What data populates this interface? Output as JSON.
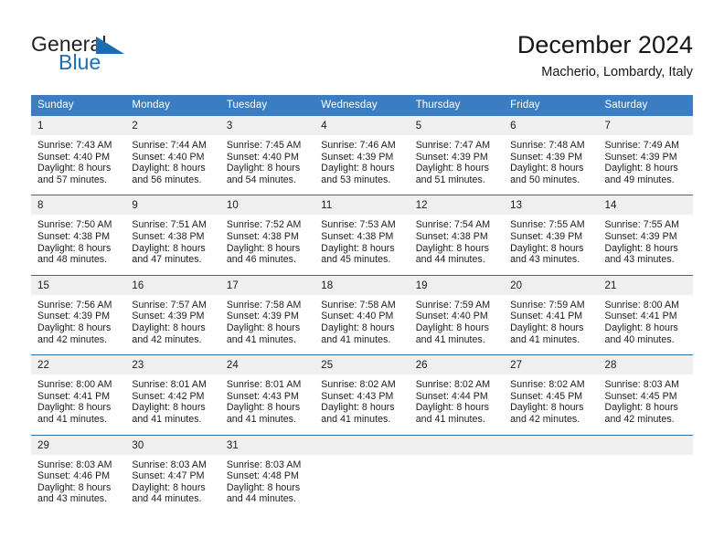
{
  "brand": {
    "name_part1": "General",
    "name_part2": "Blue",
    "accent_color": "#1b6cb0"
  },
  "header": {
    "title": "December 2024",
    "location": "Macherio, Lombardy, Italy"
  },
  "theme": {
    "header_row_bg": "#3a7dc1",
    "week_divider": "#2e6da4",
    "daynum_bg": "#efefef",
    "text": "#1b1b1b"
  },
  "weekday_headers": [
    "Sunday",
    "Monday",
    "Tuesday",
    "Wednesday",
    "Thursday",
    "Friday",
    "Saturday"
  ],
  "weeks": [
    [
      {
        "day": "1",
        "sunrise": "Sunrise: 7:43 AM",
        "sunset": "Sunset: 4:40 PM",
        "daylight_line1": "Daylight: 8 hours",
        "daylight_line2": "and 57 minutes."
      },
      {
        "day": "2",
        "sunrise": "Sunrise: 7:44 AM",
        "sunset": "Sunset: 4:40 PM",
        "daylight_line1": "Daylight: 8 hours",
        "daylight_line2": "and 56 minutes."
      },
      {
        "day": "3",
        "sunrise": "Sunrise: 7:45 AM",
        "sunset": "Sunset: 4:40 PM",
        "daylight_line1": "Daylight: 8 hours",
        "daylight_line2": "and 54 minutes."
      },
      {
        "day": "4",
        "sunrise": "Sunrise: 7:46 AM",
        "sunset": "Sunset: 4:39 PM",
        "daylight_line1": "Daylight: 8 hours",
        "daylight_line2": "and 53 minutes."
      },
      {
        "day": "5",
        "sunrise": "Sunrise: 7:47 AM",
        "sunset": "Sunset: 4:39 PM",
        "daylight_line1": "Daylight: 8 hours",
        "daylight_line2": "and 51 minutes."
      },
      {
        "day": "6",
        "sunrise": "Sunrise: 7:48 AM",
        "sunset": "Sunset: 4:39 PM",
        "daylight_line1": "Daylight: 8 hours",
        "daylight_line2": "and 50 minutes."
      },
      {
        "day": "7",
        "sunrise": "Sunrise: 7:49 AM",
        "sunset": "Sunset: 4:39 PM",
        "daylight_line1": "Daylight: 8 hours",
        "daylight_line2": "and 49 minutes."
      }
    ],
    [
      {
        "day": "8",
        "sunrise": "Sunrise: 7:50 AM",
        "sunset": "Sunset: 4:38 PM",
        "daylight_line1": "Daylight: 8 hours",
        "daylight_line2": "and 48 minutes."
      },
      {
        "day": "9",
        "sunrise": "Sunrise: 7:51 AM",
        "sunset": "Sunset: 4:38 PM",
        "daylight_line1": "Daylight: 8 hours",
        "daylight_line2": "and 47 minutes."
      },
      {
        "day": "10",
        "sunrise": "Sunrise: 7:52 AM",
        "sunset": "Sunset: 4:38 PM",
        "daylight_line1": "Daylight: 8 hours",
        "daylight_line2": "and 46 minutes."
      },
      {
        "day": "11",
        "sunrise": "Sunrise: 7:53 AM",
        "sunset": "Sunset: 4:38 PM",
        "daylight_line1": "Daylight: 8 hours",
        "daylight_line2": "and 45 minutes."
      },
      {
        "day": "12",
        "sunrise": "Sunrise: 7:54 AM",
        "sunset": "Sunset: 4:38 PM",
        "daylight_line1": "Daylight: 8 hours",
        "daylight_line2": "and 44 minutes."
      },
      {
        "day": "13",
        "sunrise": "Sunrise: 7:55 AM",
        "sunset": "Sunset: 4:39 PM",
        "daylight_line1": "Daylight: 8 hours",
        "daylight_line2": "and 43 minutes."
      },
      {
        "day": "14",
        "sunrise": "Sunrise: 7:55 AM",
        "sunset": "Sunset: 4:39 PM",
        "daylight_line1": "Daylight: 8 hours",
        "daylight_line2": "and 43 minutes."
      }
    ],
    [
      {
        "day": "15",
        "sunrise": "Sunrise: 7:56 AM",
        "sunset": "Sunset: 4:39 PM",
        "daylight_line1": "Daylight: 8 hours",
        "daylight_line2": "and 42 minutes."
      },
      {
        "day": "16",
        "sunrise": "Sunrise: 7:57 AM",
        "sunset": "Sunset: 4:39 PM",
        "daylight_line1": "Daylight: 8 hours",
        "daylight_line2": "and 42 minutes."
      },
      {
        "day": "17",
        "sunrise": "Sunrise: 7:58 AM",
        "sunset": "Sunset: 4:39 PM",
        "daylight_line1": "Daylight: 8 hours",
        "daylight_line2": "and 41 minutes."
      },
      {
        "day": "18",
        "sunrise": "Sunrise: 7:58 AM",
        "sunset": "Sunset: 4:40 PM",
        "daylight_line1": "Daylight: 8 hours",
        "daylight_line2": "and 41 minutes."
      },
      {
        "day": "19",
        "sunrise": "Sunrise: 7:59 AM",
        "sunset": "Sunset: 4:40 PM",
        "daylight_line1": "Daylight: 8 hours",
        "daylight_line2": "and 41 minutes."
      },
      {
        "day": "20",
        "sunrise": "Sunrise: 7:59 AM",
        "sunset": "Sunset: 4:41 PM",
        "daylight_line1": "Daylight: 8 hours",
        "daylight_line2": "and 41 minutes."
      },
      {
        "day": "21",
        "sunrise": "Sunrise: 8:00 AM",
        "sunset": "Sunset: 4:41 PM",
        "daylight_line1": "Daylight: 8 hours",
        "daylight_line2": "and 40 minutes."
      }
    ],
    [
      {
        "day": "22",
        "sunrise": "Sunrise: 8:00 AM",
        "sunset": "Sunset: 4:41 PM",
        "daylight_line1": "Daylight: 8 hours",
        "daylight_line2": "and 41 minutes."
      },
      {
        "day": "23",
        "sunrise": "Sunrise: 8:01 AM",
        "sunset": "Sunset: 4:42 PM",
        "daylight_line1": "Daylight: 8 hours",
        "daylight_line2": "and 41 minutes."
      },
      {
        "day": "24",
        "sunrise": "Sunrise: 8:01 AM",
        "sunset": "Sunset: 4:43 PM",
        "daylight_line1": "Daylight: 8 hours",
        "daylight_line2": "and 41 minutes."
      },
      {
        "day": "25",
        "sunrise": "Sunrise: 8:02 AM",
        "sunset": "Sunset: 4:43 PM",
        "daylight_line1": "Daylight: 8 hours",
        "daylight_line2": "and 41 minutes."
      },
      {
        "day": "26",
        "sunrise": "Sunrise: 8:02 AM",
        "sunset": "Sunset: 4:44 PM",
        "daylight_line1": "Daylight: 8 hours",
        "daylight_line2": "and 41 minutes."
      },
      {
        "day": "27",
        "sunrise": "Sunrise: 8:02 AM",
        "sunset": "Sunset: 4:45 PM",
        "daylight_line1": "Daylight: 8 hours",
        "daylight_line2": "and 42 minutes."
      },
      {
        "day": "28",
        "sunrise": "Sunrise: 8:03 AM",
        "sunset": "Sunset: 4:45 PM",
        "daylight_line1": "Daylight: 8 hours",
        "daylight_line2": "and 42 minutes."
      }
    ],
    [
      {
        "day": "29",
        "sunrise": "Sunrise: 8:03 AM",
        "sunset": "Sunset: 4:46 PM",
        "daylight_line1": "Daylight: 8 hours",
        "daylight_line2": "and 43 minutes."
      },
      {
        "day": "30",
        "sunrise": "Sunrise: 8:03 AM",
        "sunset": "Sunset: 4:47 PM",
        "daylight_line1": "Daylight: 8 hours",
        "daylight_line2": "and 44 minutes."
      },
      {
        "day": "31",
        "sunrise": "Sunrise: 8:03 AM",
        "sunset": "Sunset: 4:48 PM",
        "daylight_line1": "Daylight: 8 hours",
        "daylight_line2": "and 44 minutes."
      },
      {
        "day": "",
        "sunrise": "",
        "sunset": "",
        "daylight_line1": "",
        "daylight_line2": ""
      },
      {
        "day": "",
        "sunrise": "",
        "sunset": "",
        "daylight_line1": "",
        "daylight_line2": ""
      },
      {
        "day": "",
        "sunrise": "",
        "sunset": "",
        "daylight_line1": "",
        "daylight_line2": ""
      },
      {
        "day": "",
        "sunrise": "",
        "sunset": "",
        "daylight_line1": "",
        "daylight_line2": ""
      }
    ]
  ]
}
